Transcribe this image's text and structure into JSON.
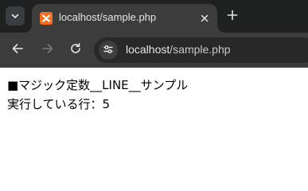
{
  "browser": {
    "tab": {
      "title": "localhost/sample.php",
      "favicon": "xampp-icon"
    },
    "toolbar": {
      "url_host": "localhost",
      "url_path": "/sample.php"
    }
  },
  "page": {
    "lines": [
      "■マジック定数__LINE__サンプル",
      "実行している行：5"
    ]
  },
  "colors": {
    "tabstrip_bg": "#1f2020",
    "toolbar_bg": "#3c3c3c",
    "omnibox_bg": "#282828",
    "favicon": "#f37021"
  }
}
